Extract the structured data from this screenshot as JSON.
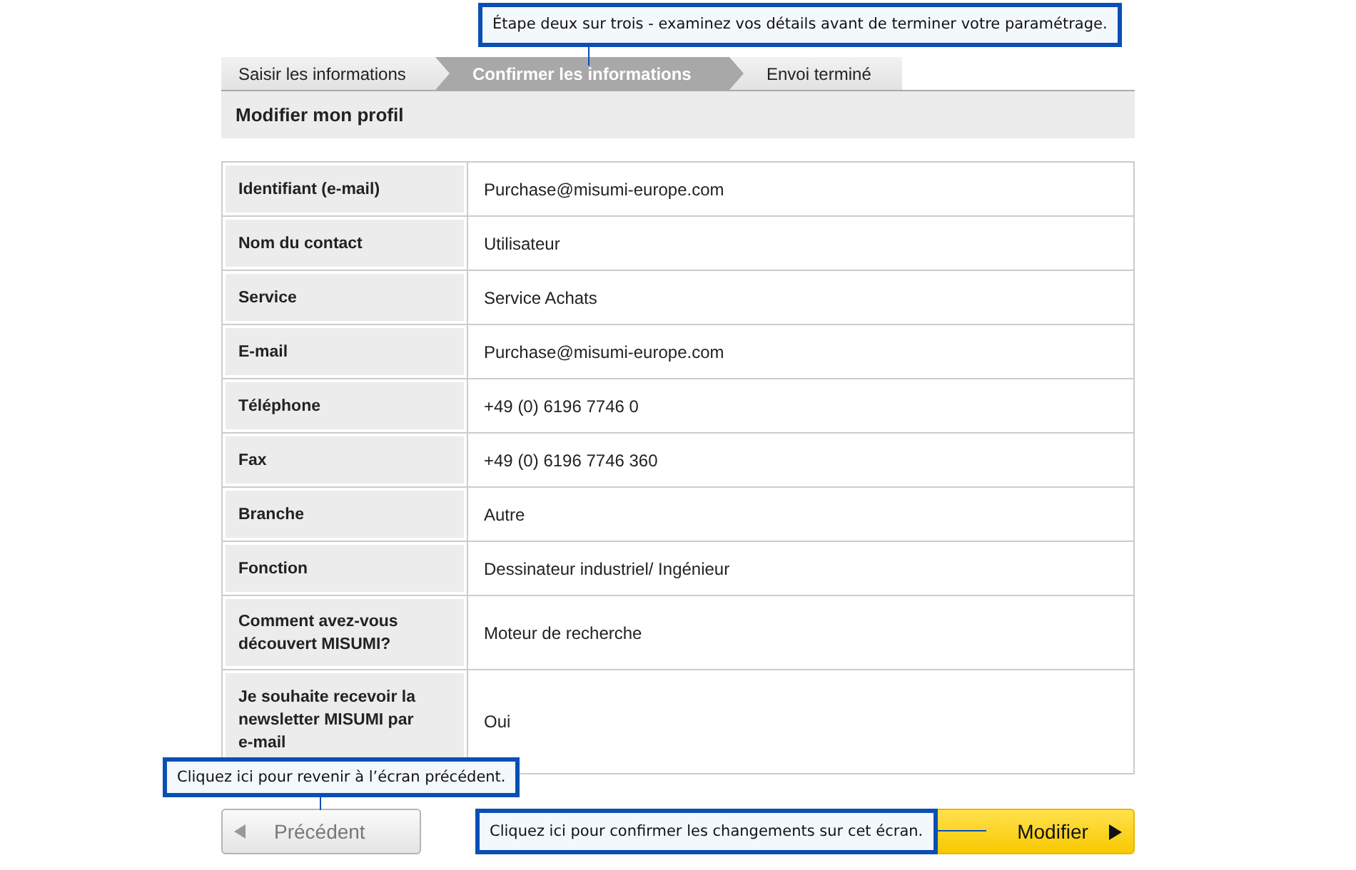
{
  "steps": {
    "callout": "Étape deux sur trois - examinez vos détails avant de terminer votre paramétrage.",
    "items": [
      {
        "label": "Saisir les informations",
        "selected": false
      },
      {
        "label": "Confirmer les informations",
        "selected": true
      },
      {
        "label": "Envoi terminé",
        "selected": false
      }
    ]
  },
  "section_title": "Modifier mon profil",
  "profile": [
    {
      "label": "Identifiant (e-mail)",
      "value": "Purchase@misumi-europe.com"
    },
    {
      "label": "Nom du contact",
      "value": "Utilisateur"
    },
    {
      "label": "Service",
      "value": "Service Achats"
    },
    {
      "label": "E-mail",
      "value": "Purchase@misumi-europe.com"
    },
    {
      "label": "Téléphone",
      "value": "+49 (0) 6196 7746 0"
    },
    {
      "label": "Fax",
      "value": "+49 (0) 6196 7746 360"
    },
    {
      "label": "Branche",
      "value": "Autre"
    },
    {
      "label": "Fonction",
      "value": "Dessinateur industriel/ Ingénieur"
    },
    {
      "label": "Comment avez-vous découvert MISUMI?",
      "value": "Moteur de recherche"
    },
    {
      "label": "Je souhaite recevoir la newsletter MISUMI par e-mail",
      "value": "Oui"
    }
  ],
  "back_button": {
    "label": "Précédent",
    "callout": "Cliquez ici pour revenir à l’écran précédent."
  },
  "submit_button": {
    "label": "Modifier",
    "callout": "Cliquez ici pour confirmer les changements sur cet écran."
  }
}
